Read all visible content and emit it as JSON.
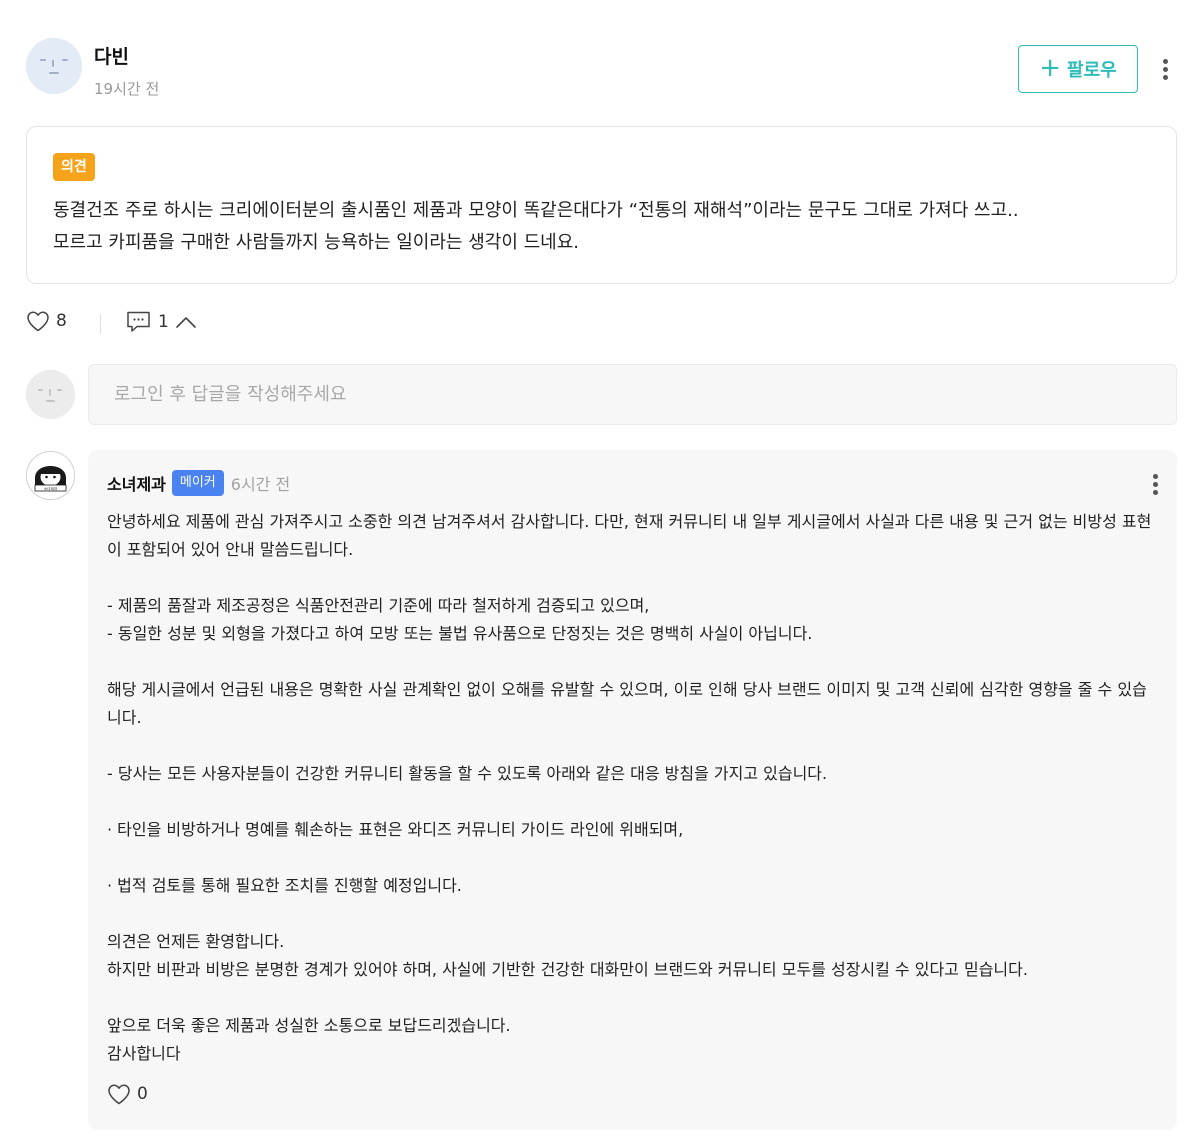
{
  "post": {
    "author": "다빈",
    "time": "19시간 전",
    "follow_label": "팔로우",
    "tag": "의견",
    "body": "동결건조 주로 하시는 크리에이터분의 출시품인 제품과 모양이 똑같은대다가 “전통의 재해석”이라는 문구도 그대로 가져다 쓰고..\n모르고 카피품을 구매한 사람들까지 능욕하는 일이라는 생각이 드네요.",
    "like_count": "8",
    "comment_count": "1"
  },
  "reply": {
    "placeholder": "로그인 후 답글을 작성해주세요"
  },
  "comment": {
    "author": "소녀제과",
    "badge": "메이커",
    "time": "6시간 전",
    "avatar_text": "소녀제과",
    "paragraphs": [
      "안녕하세요 제품에 관심 가져주시고 소중한 의견 남겨주셔서 감사합니다. 다만, 현재 커뮤니티 내 일부 게시글에서 사실과 다른 내용 및 근거 없는 비방성 표현이 포함되어 있어 안내 말씀드립니다.",
      "- 제품의 품잘과 제조공정은 식품안전관리 기준에 따라 철저하게 검증되고 있으며,\n- 동일한 성분 및 외형을 가졌다고 하여 모방 또는 불법 유사품으로 단정짓는 것은 명백히 사실이 아닙니다.",
      "해당 게시글에서 언급된 내용은 명확한 사실 관계확인 없이 오해를 유발할 수 있으며, 이로 인해 당사 브랜드 이미지 및 고객 신뢰에 심각한 영향을 줄 수 있습니다.",
      "- 당사는 모든 사용자분들이 건강한 커뮤니티 활동을 할 수 있도록 아래와 같은 대응 방침을 가지고 있습니다.",
      "· 타인을 비방하거나 명예를 훼손하는 표현은 와디즈 커뮤니티 가이드 라인에 위배되며,",
      "· 법적 검토를 통해 필요한 조치를 진행할 예정입니다.",
      "의견은 언제든 환영합니다.\n하지만 비판과 비방은 분명한 경계가 있어야 하며, 사실에 기반한 건강한 대화만이 브랜드와 커뮤니티 모두를 성장시킬 수 있다고 믿습니다.",
      "앞으로 더욱 좋은 제품과 성실한 소통으로 보답드리겠습니다.\n감사합니다"
    ],
    "like_count": "0"
  },
  "colors": {
    "follow": "#2dbcb6",
    "tag": "#f5a31a",
    "maker_badge": "#4a82f0",
    "avatar_bg": "#e3ebf6"
  },
  "icons": {
    "author_avatar": "default-face-avatar",
    "more": "kebab-vertical-icon",
    "follow": "plus-icon",
    "like": "heart-outline-icon",
    "comment": "speech-bubble-icon",
    "toggle": "chevron-up-icon"
  }
}
